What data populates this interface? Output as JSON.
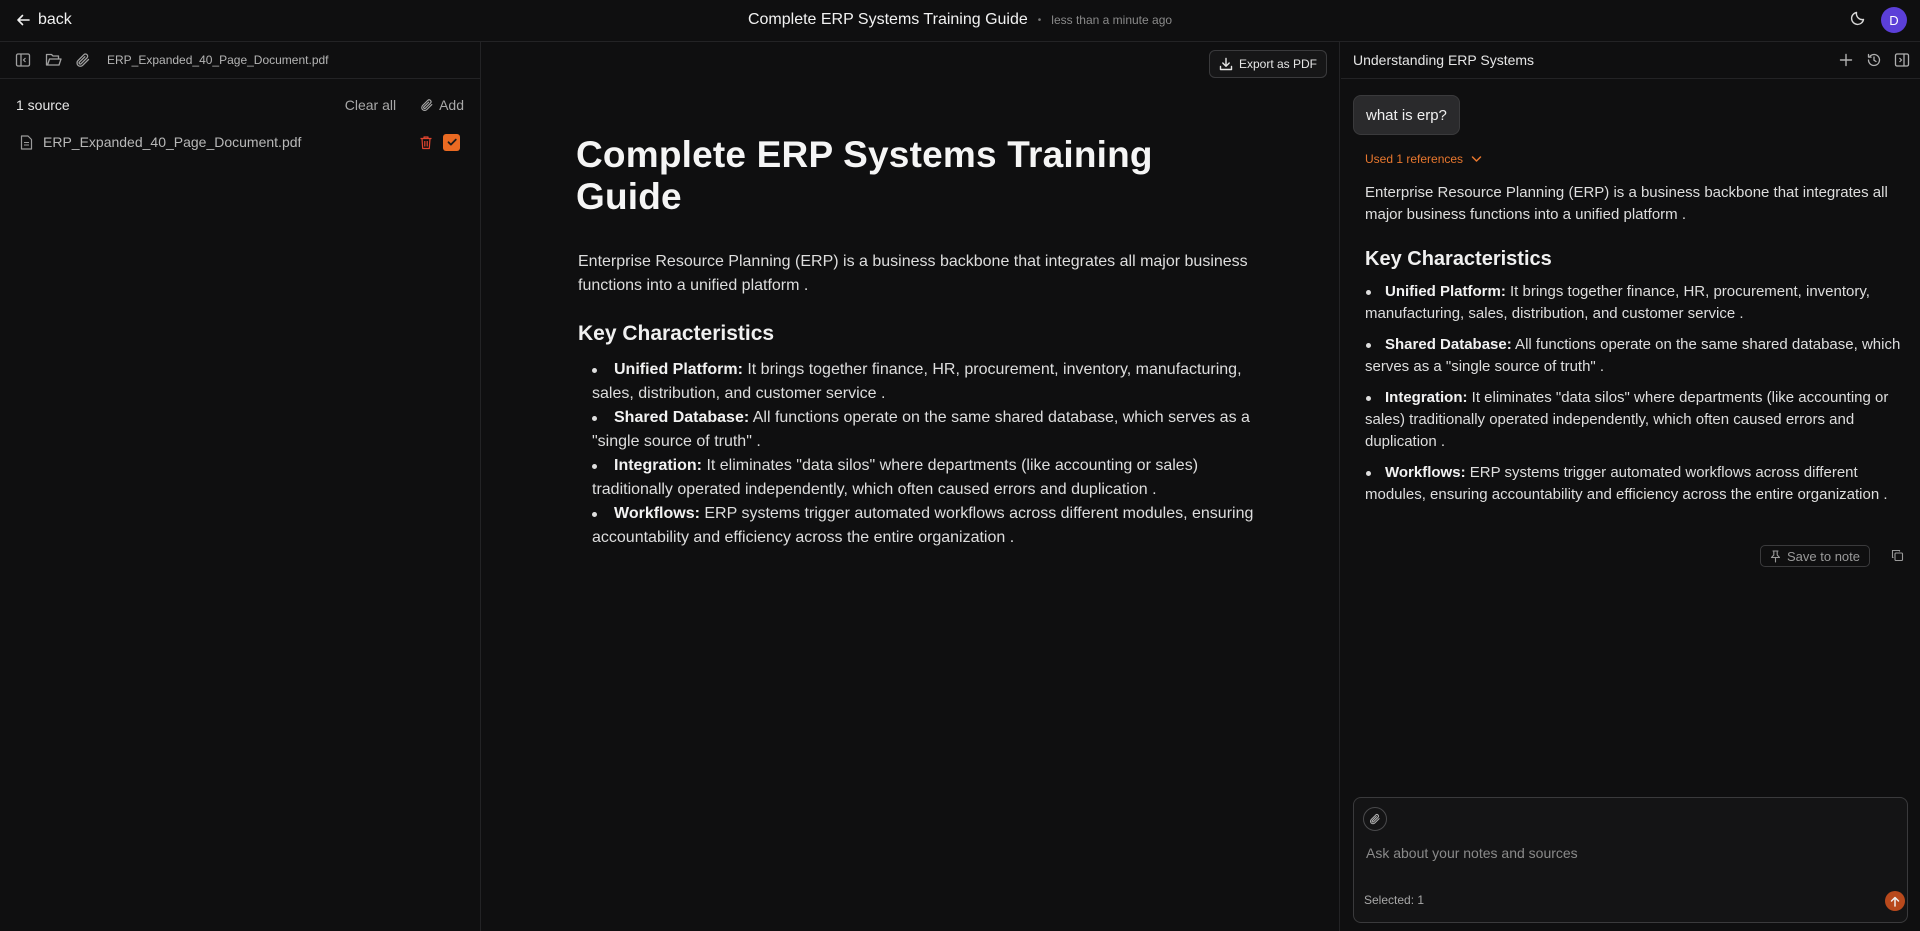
{
  "topbar": {
    "back_label": "back",
    "doc_title": "Complete ERP Systems Training Guide",
    "separator": "•",
    "saved_time": "less than a minute ago",
    "avatar_initial": "D"
  },
  "left_panel": {
    "open_filename": "ERP_Expanded_40_Page_Document.pdf",
    "sources_count": "1 source",
    "clear_all": "Clear all",
    "add": "Add",
    "sources": [
      {
        "name": "ERP_Expanded_40_Page_Document.pdf",
        "selected": true
      }
    ]
  },
  "document": {
    "export_label": "Export as PDF",
    "title": "Complete ERP Systems Training Guide",
    "intro": "Enterprise Resource Planning (ERP) is a business backbone that integrates all major business functions into a unified platform .",
    "section_heading": "Key Characteristics",
    "items": [
      {
        "term": "Unified Platform:",
        "text": " It brings together finance, HR, procurement, inventory, manufacturing, sales, distribution, and customer service ."
      },
      {
        "term": "Shared Database:",
        "text": " All functions operate on the same shared database, which serves as a \"single source of truth\" ."
      },
      {
        "term": "Integration:",
        "text": " It eliminates \"data silos\" where departments (like accounting or sales) traditionally operated independently, which often caused errors and duplication ."
      },
      {
        "term": "Workflows:",
        "text": " ERP systems trigger automated workflows across different modules, ensuring accountability and efficiency across the entire organization ."
      }
    ]
  },
  "chat": {
    "title": "Understanding ERP Systems",
    "user_message": "what is erp?",
    "references": "Used 1 references",
    "answer_intro": "Enterprise Resource Planning (ERP) is a business backbone that integrates all major business functions into a unified platform .",
    "answer_heading": "Key Characteristics",
    "answer_items": [
      {
        "term": "Unified Platform:",
        "text": " It brings together finance, HR, procurement, inventory, manufacturing, sales, distribution, and customer service ."
      },
      {
        "term": "Shared Database:",
        "text": " All functions operate on the same shared database, which serves as a \"single source of truth\" ."
      },
      {
        "term": "Integration:",
        "text": " It eliminates \"data silos\" where departments (like accounting or sales) traditionally operated independently, which often caused errors and duplication ."
      },
      {
        "term": "Workflows:",
        "text": " ERP systems trigger automated workflows across different modules, ensuring accountability and efficiency across the entire organization ."
      }
    ],
    "save_to_note": "Save to note",
    "composer_placeholder": "Ask about your notes and sources",
    "composer_value": "",
    "selected_label": "Selected: 1"
  },
  "colors": {
    "background": "#0f0f10",
    "accent": "#ea6a22",
    "reference_link": "#e8772e",
    "avatar": "#5b3fd8",
    "delete_icon": "#e0452f"
  }
}
